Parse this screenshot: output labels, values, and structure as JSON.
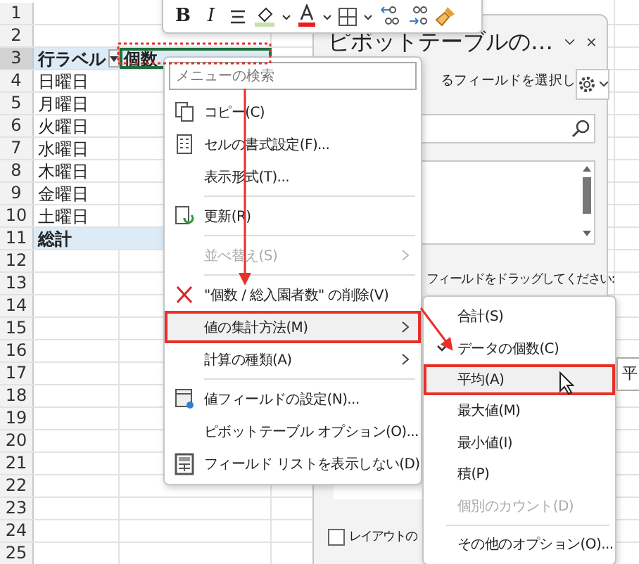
{
  "sheet": {
    "rows": [
      {
        "label": "1",
        "selected": false
      },
      {
        "label": "2",
        "selected": false
      },
      {
        "label": "3",
        "selected": true
      },
      {
        "label": "4",
        "selected": false
      },
      {
        "label": "5",
        "selected": false
      },
      {
        "label": "6",
        "selected": false
      },
      {
        "label": "7",
        "selected": false
      },
      {
        "label": "8",
        "selected": false
      },
      {
        "label": "9",
        "selected": false
      },
      {
        "label": "10",
        "selected": false
      },
      {
        "label": "11",
        "selected": false
      },
      {
        "label": "12",
        "selected": false
      },
      {
        "label": "13",
        "selected": false
      },
      {
        "label": "14",
        "selected": false
      },
      {
        "label": "15",
        "selected": false
      },
      {
        "label": "16",
        "selected": false
      },
      {
        "label": "17",
        "selected": false
      },
      {
        "label": "18",
        "selected": false
      },
      {
        "label": "19",
        "selected": false
      },
      {
        "label": "20",
        "selected": false
      },
      {
        "label": "21",
        "selected": false
      },
      {
        "label": "22",
        "selected": false
      },
      {
        "label": "23",
        "selected": false
      },
      {
        "label": "24",
        "selected": false
      },
      {
        "label": "25",
        "selected": false
      }
    ],
    "pivot": {
      "row_label": "行ラベル",
      "value_label": "個数",
      "items": [
        "日曜日",
        "月曜日",
        "火曜日",
        "水曜日",
        "木曜日",
        "金曜日",
        "土曜日"
      ],
      "total": "総計"
    }
  },
  "mini_toolbar": {
    "bold": "B",
    "italic": "I"
  },
  "pane": {
    "title": "ピボットテーブルの…",
    "field_hint": "るフィールドを選択し",
    "drag_hint": "フィールドをドラッグしてください:",
    "layout_checkbox": {
      "label": "レイアウトの",
      "checked": false
    }
  },
  "context_menu": {
    "search_placeholder": "メニューの検索",
    "items": [
      {
        "kind": "item",
        "label": "コピー(C)",
        "disabled": false,
        "submenu": false,
        "selected": false
      },
      {
        "kind": "item",
        "label": "セルの書式設定(F)...",
        "disabled": false,
        "submenu": false,
        "selected": false
      },
      {
        "kind": "item",
        "label": "表示形式(T)...",
        "disabled": false,
        "submenu": false,
        "selected": false
      },
      {
        "kind": "divider"
      },
      {
        "kind": "item",
        "label": "更新(R)",
        "disabled": false,
        "submenu": false,
        "selected": false
      },
      {
        "kind": "divider"
      },
      {
        "kind": "item",
        "label": "並べ替え(S)",
        "disabled": true,
        "submenu": true,
        "selected": false
      },
      {
        "kind": "divider"
      },
      {
        "kind": "item",
        "label": "\"個数 / 総入園者数\" の削除(V)",
        "disabled": false,
        "submenu": false,
        "selected": false
      },
      {
        "kind": "item",
        "label": "値の集計方法(M)",
        "disabled": false,
        "submenu": true,
        "selected": true
      },
      {
        "kind": "item",
        "label": "計算の種類(A)",
        "disabled": false,
        "submenu": true,
        "selected": false
      },
      {
        "kind": "divider"
      },
      {
        "kind": "item",
        "label": "値フィールドの設定(N)...",
        "disabled": false,
        "submenu": false,
        "selected": false
      },
      {
        "kind": "item",
        "label": "ピボットテーブル オプション(O)...",
        "disabled": false,
        "submenu": false,
        "selected": false
      },
      {
        "kind": "item",
        "label": "フィールド リストを表示しない(D)",
        "disabled": false,
        "submenu": false,
        "selected": false
      }
    ]
  },
  "submenu": {
    "items": [
      {
        "kind": "item",
        "label": "合計(S)",
        "checked": false,
        "selected": false,
        "disabled": false
      },
      {
        "kind": "item",
        "label": "データの個数(C)",
        "checked": true,
        "selected": false,
        "disabled": false
      },
      {
        "kind": "item",
        "label": "平均(A)",
        "checked": false,
        "selected": true,
        "disabled": false
      },
      {
        "kind": "item",
        "label": "最大値(M)",
        "checked": false,
        "selected": false,
        "disabled": false
      },
      {
        "kind": "item",
        "label": "最小値(I)",
        "checked": false,
        "selected": false,
        "disabled": false
      },
      {
        "kind": "item",
        "label": "積(P)",
        "checked": false,
        "selected": false,
        "disabled": false
      },
      {
        "kind": "item",
        "label": "個別のカウント(D)",
        "checked": false,
        "selected": false,
        "disabled": true
      },
      {
        "kind": "divider"
      },
      {
        "kind": "item",
        "label": "その他のオプション(O)...",
        "checked": false,
        "selected": false,
        "disabled": false
      }
    ]
  },
  "tooltip": "平"
}
